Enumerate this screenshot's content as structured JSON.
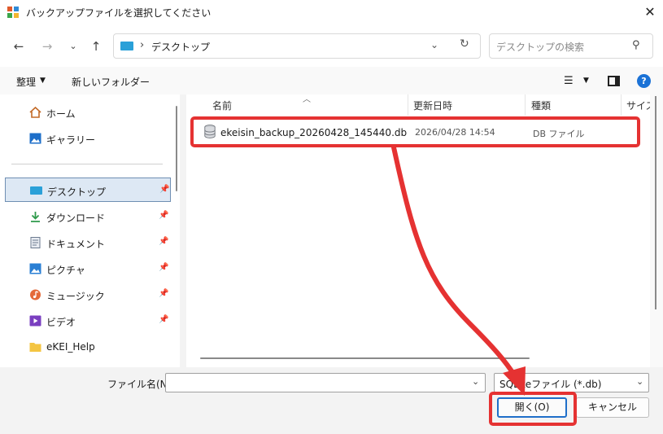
{
  "window": {
    "title": "バックアップファイルを選択してください"
  },
  "address": {
    "separator": "›",
    "location": "デスクトップ",
    "search_placeholder": "デスクトップの検索"
  },
  "toolbar": {
    "organize": "整理",
    "new_folder": "新しいフォルダー"
  },
  "nav": {
    "items": [
      {
        "label": "ホーム",
        "icon": "home-icon",
        "pinned": false
      },
      {
        "label": "ギャラリー",
        "icon": "gallery-icon",
        "pinned": false
      },
      {
        "label": "デスクトップ",
        "icon": "desktop-icon",
        "pinned": true,
        "selected": true
      },
      {
        "label": "ダウンロード",
        "icon": "download-icon",
        "pinned": true
      },
      {
        "label": "ドキュメント",
        "icon": "document-icon",
        "pinned": true
      },
      {
        "label": "ピクチャ",
        "icon": "pictures-icon",
        "pinned": true
      },
      {
        "label": "ミュージック",
        "icon": "music-icon",
        "pinned": true
      },
      {
        "label": "ビデオ",
        "icon": "video-icon",
        "pinned": true
      },
      {
        "label": "eKEI_Help",
        "icon": "folder-icon",
        "pinned": false
      }
    ]
  },
  "columns": {
    "name": "名前",
    "modified": "更新日時",
    "type": "種類",
    "size": "サイズ"
  },
  "files": [
    {
      "name": "ekeisin_backup_20260428_145440.db",
      "modified": "2026/04/28 14:54",
      "type": "DB ファイル"
    }
  ],
  "bottom": {
    "filename_label": "ファイル名(N):",
    "filename_value": "",
    "filter": "SQLiteファイル (*.db)",
    "open": "開く(O)",
    "cancel": "キャンセル"
  },
  "colors": {
    "annotation": "#e53232",
    "accent": "#1f6fc9",
    "selection": "#dde8f4"
  }
}
